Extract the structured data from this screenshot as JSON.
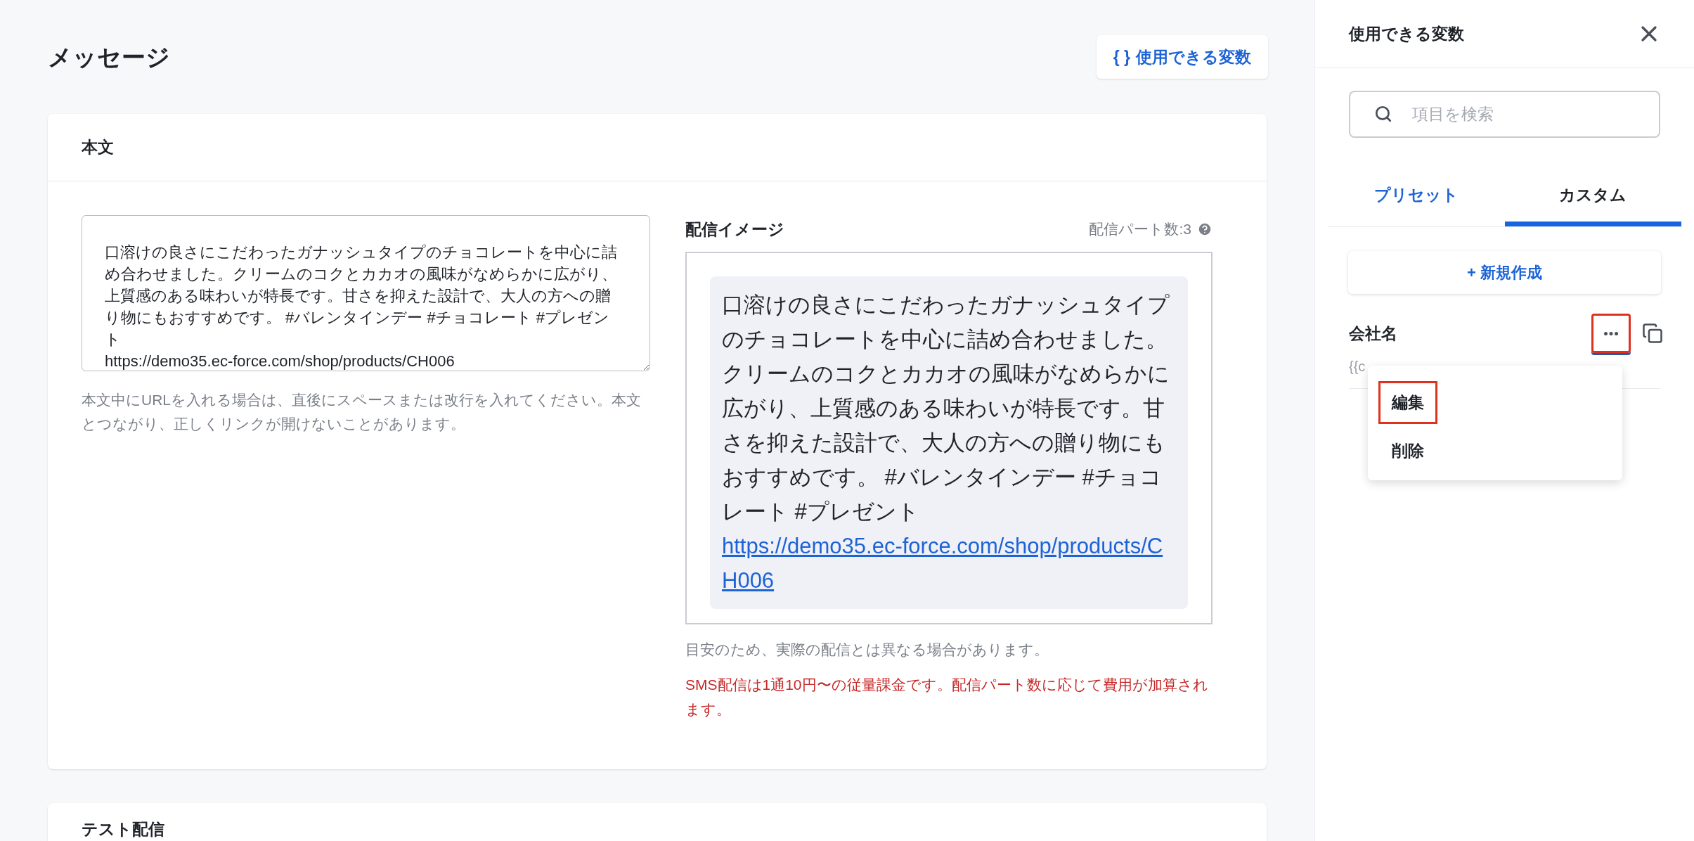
{
  "page": {
    "title": "メッセージ",
    "variables_button": {
      "icon_text": "{ }",
      "label": "使用できる変数"
    }
  },
  "body_card": {
    "title": "本文",
    "message_field": {
      "value": "口溶けの良さにこだわったガナッシュタイプのチョコレートを中心に詰め合わせました。クリームのコクとカカオの風味がなめらかに広がり、上質感のある味わいが特長です。甘さを抑えた設計で、大人の方への贈り物にもおすすめです。 #バレンタインデー #チョコレート #プレゼント\nhttps://demo35.ec-force.com/shop/products/CH006"
    },
    "field_note": "本文中にURLを入れる場合は、直後にスペースまたは改行を入れてください。本文とつながり、正しくリンクが開けないことがあります。",
    "preview": {
      "title": "配信イメージ",
      "parts": "配信パート数:3",
      "text": "口溶けの良さにこだわったガナッシュタイプのチョコレートを中心に詰め合わせました。クリームのコクとカカオの風味がなめらかに広がり、上質感のある味わいが特長です。甘さを抑えた設計で、大人の方への贈り物にもおすすめです。 #バレンタインデー #チョコレート #プレゼント",
      "link": "https://demo35.ec-force.com/shop/products/CH006",
      "note": "目安のため、実際の配信とは異なる場合があります。",
      "warning": "SMS配信は1通10円〜の従量課金です。配信パート数に応じて費用が加算されます。"
    }
  },
  "test_card": {
    "title": "テスト配信"
  },
  "panel": {
    "title": "使用できる変数",
    "search": {
      "placeholder": "項目を検索"
    },
    "tabs": [
      {
        "label": "プリセット",
        "selected": false
      },
      {
        "label": "カスタム",
        "selected": true
      }
    ],
    "new_button": "+ 新規作成",
    "variables": [
      {
        "name": "会社名",
        "code": "{{c",
        "menu_highlighted": true
      }
    ],
    "menu": [
      {
        "label": "編集",
        "highlighted": true
      },
      {
        "label": "削除",
        "highlighted": false
      }
    ]
  }
}
